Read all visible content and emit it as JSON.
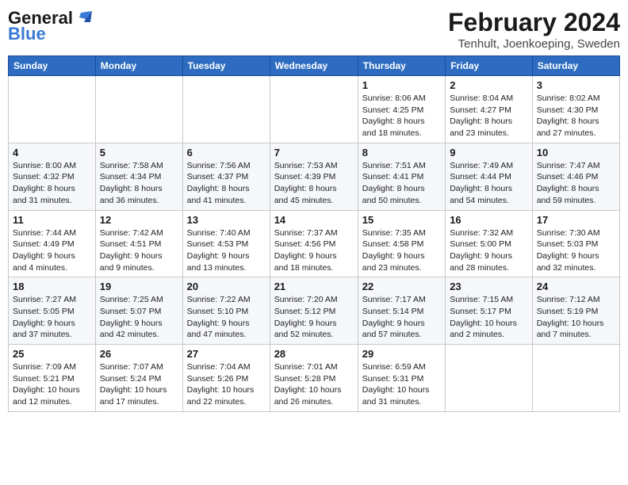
{
  "logo": {
    "general": "General",
    "blue": "Blue"
  },
  "header": {
    "title": "February 2024",
    "subtitle": "Tenhult, Joenkoeping, Sweden"
  },
  "columns": [
    "Sunday",
    "Monday",
    "Tuesday",
    "Wednesday",
    "Thursday",
    "Friday",
    "Saturday"
  ],
  "weeks": [
    [
      {
        "day": "",
        "info": ""
      },
      {
        "day": "",
        "info": ""
      },
      {
        "day": "",
        "info": ""
      },
      {
        "day": "",
        "info": ""
      },
      {
        "day": "1",
        "info": "Sunrise: 8:06 AM\nSunset: 4:25 PM\nDaylight: 8 hours\nand 18 minutes."
      },
      {
        "day": "2",
        "info": "Sunrise: 8:04 AM\nSunset: 4:27 PM\nDaylight: 8 hours\nand 23 minutes."
      },
      {
        "day": "3",
        "info": "Sunrise: 8:02 AM\nSunset: 4:30 PM\nDaylight: 8 hours\nand 27 minutes."
      }
    ],
    [
      {
        "day": "4",
        "info": "Sunrise: 8:00 AM\nSunset: 4:32 PM\nDaylight: 8 hours\nand 31 minutes."
      },
      {
        "day": "5",
        "info": "Sunrise: 7:58 AM\nSunset: 4:34 PM\nDaylight: 8 hours\nand 36 minutes."
      },
      {
        "day": "6",
        "info": "Sunrise: 7:56 AM\nSunset: 4:37 PM\nDaylight: 8 hours\nand 41 minutes."
      },
      {
        "day": "7",
        "info": "Sunrise: 7:53 AM\nSunset: 4:39 PM\nDaylight: 8 hours\nand 45 minutes."
      },
      {
        "day": "8",
        "info": "Sunrise: 7:51 AM\nSunset: 4:41 PM\nDaylight: 8 hours\nand 50 minutes."
      },
      {
        "day": "9",
        "info": "Sunrise: 7:49 AM\nSunset: 4:44 PM\nDaylight: 8 hours\nand 54 minutes."
      },
      {
        "day": "10",
        "info": "Sunrise: 7:47 AM\nSunset: 4:46 PM\nDaylight: 8 hours\nand 59 minutes."
      }
    ],
    [
      {
        "day": "11",
        "info": "Sunrise: 7:44 AM\nSunset: 4:49 PM\nDaylight: 9 hours\nand 4 minutes."
      },
      {
        "day": "12",
        "info": "Sunrise: 7:42 AM\nSunset: 4:51 PM\nDaylight: 9 hours\nand 9 minutes."
      },
      {
        "day": "13",
        "info": "Sunrise: 7:40 AM\nSunset: 4:53 PM\nDaylight: 9 hours\nand 13 minutes."
      },
      {
        "day": "14",
        "info": "Sunrise: 7:37 AM\nSunset: 4:56 PM\nDaylight: 9 hours\nand 18 minutes."
      },
      {
        "day": "15",
        "info": "Sunrise: 7:35 AM\nSunset: 4:58 PM\nDaylight: 9 hours\nand 23 minutes."
      },
      {
        "day": "16",
        "info": "Sunrise: 7:32 AM\nSunset: 5:00 PM\nDaylight: 9 hours\nand 28 minutes."
      },
      {
        "day": "17",
        "info": "Sunrise: 7:30 AM\nSunset: 5:03 PM\nDaylight: 9 hours\nand 32 minutes."
      }
    ],
    [
      {
        "day": "18",
        "info": "Sunrise: 7:27 AM\nSunset: 5:05 PM\nDaylight: 9 hours\nand 37 minutes."
      },
      {
        "day": "19",
        "info": "Sunrise: 7:25 AM\nSunset: 5:07 PM\nDaylight: 9 hours\nand 42 minutes."
      },
      {
        "day": "20",
        "info": "Sunrise: 7:22 AM\nSunset: 5:10 PM\nDaylight: 9 hours\nand 47 minutes."
      },
      {
        "day": "21",
        "info": "Sunrise: 7:20 AM\nSunset: 5:12 PM\nDaylight: 9 hours\nand 52 minutes."
      },
      {
        "day": "22",
        "info": "Sunrise: 7:17 AM\nSunset: 5:14 PM\nDaylight: 9 hours\nand 57 minutes."
      },
      {
        "day": "23",
        "info": "Sunrise: 7:15 AM\nSunset: 5:17 PM\nDaylight: 10 hours\nand 2 minutes."
      },
      {
        "day": "24",
        "info": "Sunrise: 7:12 AM\nSunset: 5:19 PM\nDaylight: 10 hours\nand 7 minutes."
      }
    ],
    [
      {
        "day": "25",
        "info": "Sunrise: 7:09 AM\nSunset: 5:21 PM\nDaylight: 10 hours\nand 12 minutes."
      },
      {
        "day": "26",
        "info": "Sunrise: 7:07 AM\nSunset: 5:24 PM\nDaylight: 10 hours\nand 17 minutes."
      },
      {
        "day": "27",
        "info": "Sunrise: 7:04 AM\nSunset: 5:26 PM\nDaylight: 10 hours\nand 22 minutes."
      },
      {
        "day": "28",
        "info": "Sunrise: 7:01 AM\nSunset: 5:28 PM\nDaylight: 10 hours\nand 26 minutes."
      },
      {
        "day": "29",
        "info": "Sunrise: 6:59 AM\nSunset: 5:31 PM\nDaylight: 10 hours\nand 31 minutes."
      },
      {
        "day": "",
        "info": ""
      },
      {
        "day": "",
        "info": ""
      }
    ]
  ]
}
